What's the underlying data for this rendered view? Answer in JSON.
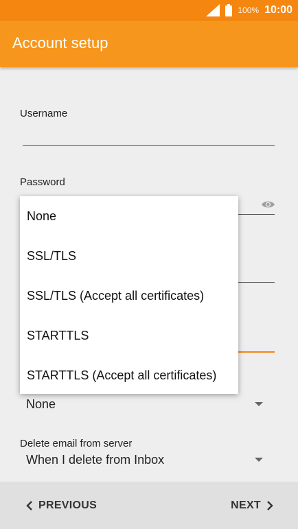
{
  "status_bar": {
    "battery_percent": "100%",
    "time": "10:00",
    "icons": [
      "cell-signal-icon",
      "battery-icon"
    ]
  },
  "app_bar": {
    "title": "Account setup"
  },
  "form": {
    "username": {
      "label": "Username",
      "value": ""
    },
    "password": {
      "label": "Password",
      "value": "",
      "toggle_icon": "eye-icon"
    },
    "security_type": {
      "selected": "None",
      "icon": "dropdown-arrow-icon"
    },
    "delete_email": {
      "label": "Delete email from server",
      "selected": "When I delete from Inbox",
      "icon": "dropdown-arrow-icon"
    }
  },
  "popup": {
    "options": [
      "None",
      "SSL/TLS",
      "SSL/TLS (Accept all certificates)",
      "STARTTLS",
      "STARTTLS (Accept all certificates)"
    ]
  },
  "bottom_nav": {
    "previous_label": "PREVIOUS",
    "next_label": "NEXT",
    "previous_icon": "chevron-left-icon",
    "next_icon": "chevron-right-icon"
  },
  "colors": {
    "status_bar": "#f5860f",
    "app_bar": "#f7961c",
    "accent": "#f5860f",
    "background": "#eeeeee",
    "bottom_bar": "#e0e0e0"
  }
}
